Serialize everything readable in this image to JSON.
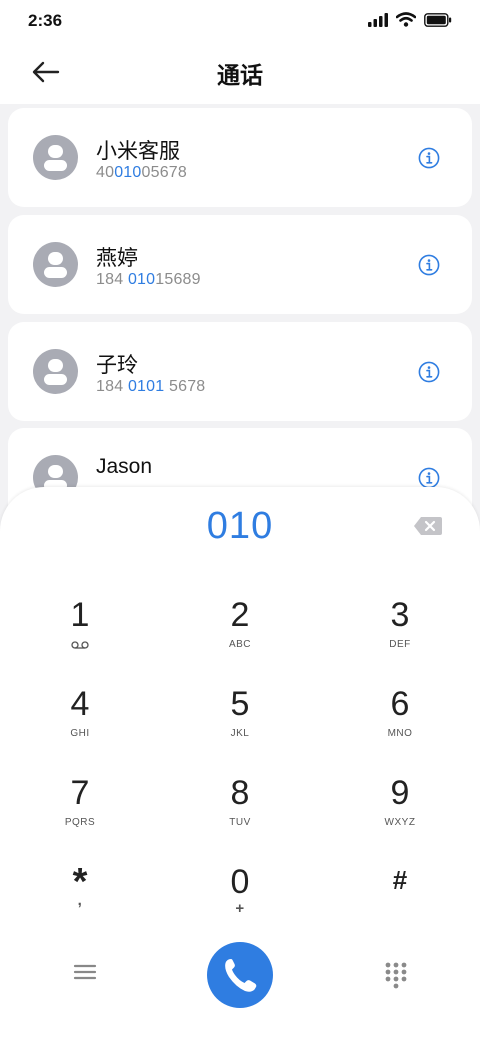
{
  "status_bar": {
    "time": "2:36"
  },
  "header": {
    "title": "通话"
  },
  "contacts": [
    {
      "name": "小米客服",
      "num_pre": "40",
      "num_hl": "010",
      "num_post": "05678"
    },
    {
      "name": "燕婷",
      "num_pre": "184 ",
      "num_hl": "010",
      "num_post": "15689"
    },
    {
      "name": "子玲",
      "num_pre": "184 ",
      "num_hl": "0101",
      "num_post": " 5678"
    },
    {
      "name": "Jason",
      "num_pre": "",
      "num_hl": "",
      "num_post": ""
    }
  ],
  "dialpad": {
    "entered": "010",
    "keys": [
      {
        "digit": "1",
        "letters": ""
      },
      {
        "digit": "2",
        "letters": "ABC"
      },
      {
        "digit": "3",
        "letters": "DEF"
      },
      {
        "digit": "4",
        "letters": "GHI"
      },
      {
        "digit": "5",
        "letters": "JKL"
      },
      {
        "digit": "6",
        "letters": "MNO"
      },
      {
        "digit": "7",
        "letters": "PQRS"
      },
      {
        "digit": "8",
        "letters": "TUV"
      },
      {
        "digit": "9",
        "letters": "WXYZ"
      },
      {
        "digit": "*",
        "letters": ","
      },
      {
        "digit": "0",
        "letters": "+"
      },
      {
        "digit": "#",
        "letters": ""
      }
    ]
  },
  "colors": {
    "accent": "#2f7de1",
    "background": "#f2f2f4",
    "avatar": "#a9abb4"
  },
  "icons": [
    "back-arrow-icon",
    "info-icon",
    "backspace-icon",
    "voicemail-icon",
    "menu-icon",
    "phone-icon",
    "keypad-icon",
    "signal-icon",
    "wifi-icon",
    "battery-icon"
  ]
}
